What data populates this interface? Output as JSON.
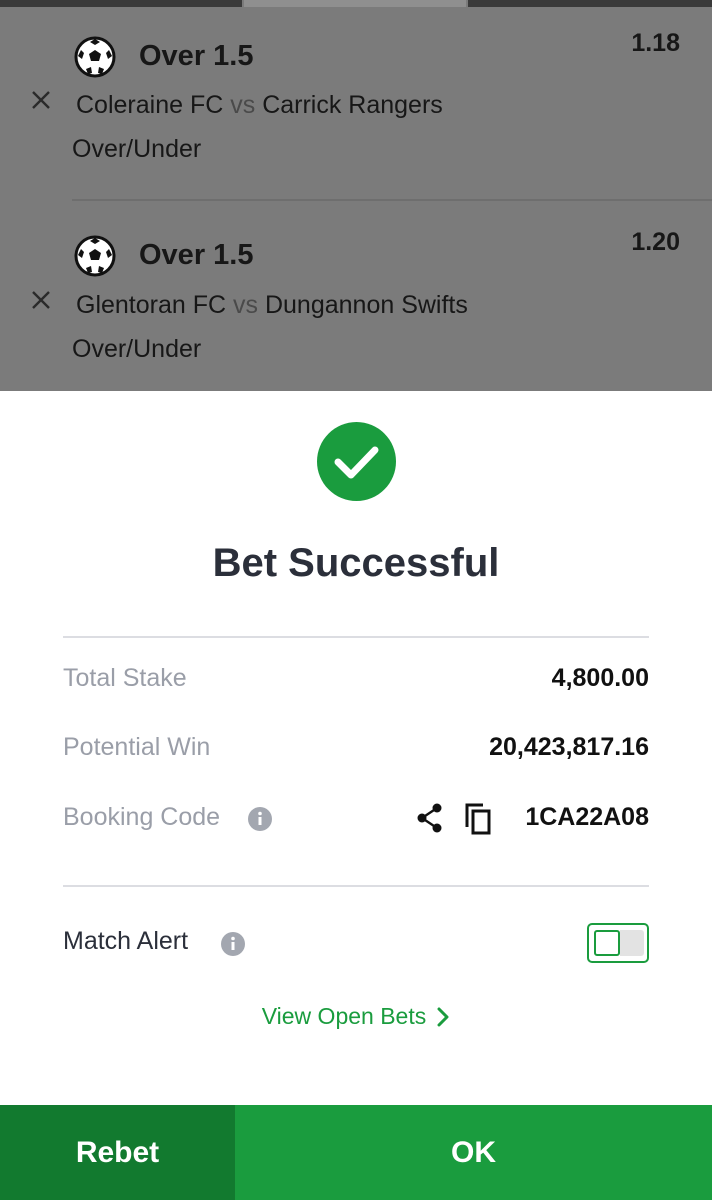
{
  "selections": [
    {
      "pick": "Over 1.5",
      "odds": "1.18",
      "home": "Coleraine FC",
      "vs": "vs",
      "away": "Carrick Rangers",
      "market": "Over/Under"
    },
    {
      "pick": "Over 1.5",
      "odds": "1.20",
      "home": "Glentoran FC",
      "vs": "vs",
      "away": "Dungannon Swifts",
      "market": "Over/Under"
    }
  ],
  "dialog": {
    "title": "Bet Successful",
    "total_stake_label": "Total Stake",
    "total_stake_value": "4,800.00",
    "potential_win_label": "Potential Win",
    "potential_win_value": "20,423,817.16",
    "booking_code_label": "Booking Code",
    "booking_code_value": "1CA22A08",
    "match_alert_label": "Match Alert",
    "match_alert_on": false,
    "view_open_bets": "View Open Bets"
  },
  "buttons": {
    "rebet": "Rebet",
    "ok": "OK"
  },
  "colors": {
    "accent_green": "#1a9c3e",
    "dark_green": "#127a2f",
    "overlay_gray": "#7b7b7b"
  },
  "icons": [
    "soccer-ball-icon",
    "close-icon",
    "check-circle-icon",
    "info-icon",
    "share-icon",
    "copy-icon",
    "chevron-right-icon"
  ]
}
